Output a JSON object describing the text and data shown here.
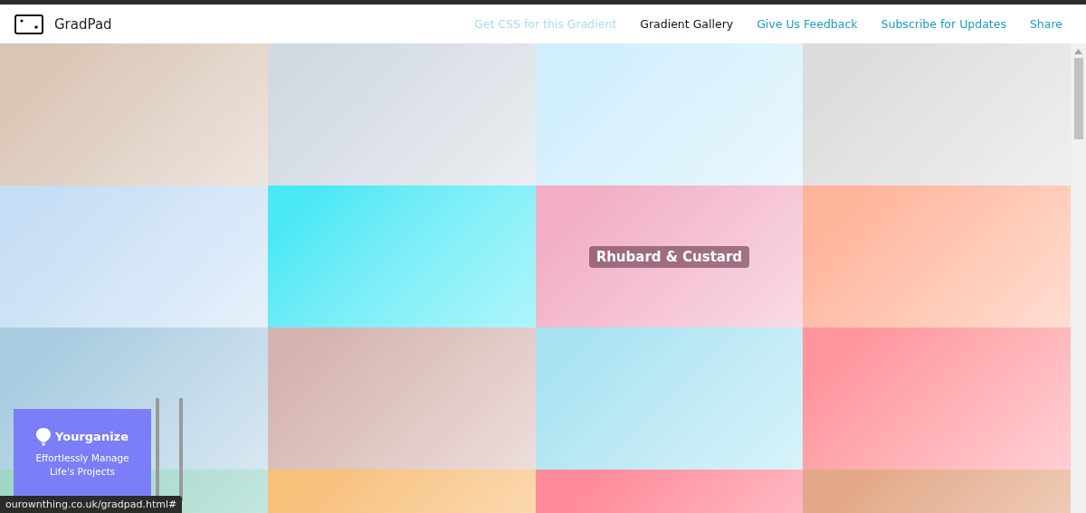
{
  "header": {
    "logo_text": "GradPad",
    "nav": [
      {
        "label": "Get CSS for this Gradient",
        "selected": false,
        "disabled": true
      },
      {
        "label": "Gradient Gallery",
        "selected": true,
        "disabled": false
      },
      {
        "label": "Give Us Feedback",
        "selected": false,
        "disabled": false
      },
      {
        "label": "Subscribe for Updates",
        "selected": false,
        "disabled": false
      },
      {
        "label": "Share",
        "selected": false,
        "disabled": false
      }
    ]
  },
  "tiles": [
    {
      "color": "#d9c5b5"
    },
    {
      "color": "#d2d9e1"
    },
    {
      "color": "#d0eefc"
    },
    {
      "color": "#dcdcdc"
    },
    {
      "color": "#c6def5"
    },
    {
      "color": "#4be9f5"
    },
    {
      "color": "#f1aec4",
      "label": "Rhubard & Custard"
    },
    {
      "color": "#ffb49b"
    },
    {
      "color": "#a8cbe0"
    },
    {
      "color": "#d5b4b0"
    },
    {
      "color": "#a9e3f2"
    },
    {
      "color": "#ff959c"
    },
    {
      "color": "#9fd6c8"
    },
    {
      "color": "#f7c07b"
    },
    {
      "color": "#ff8a9a"
    },
    {
      "color": "#e2a888"
    }
  ],
  "ad": {
    "brand": "Yourganize",
    "tagline": "Effortlessly Manage Life's Projects"
  },
  "status_bar": {
    "url": "ourownthing.co.uk/gradpad.html#"
  }
}
